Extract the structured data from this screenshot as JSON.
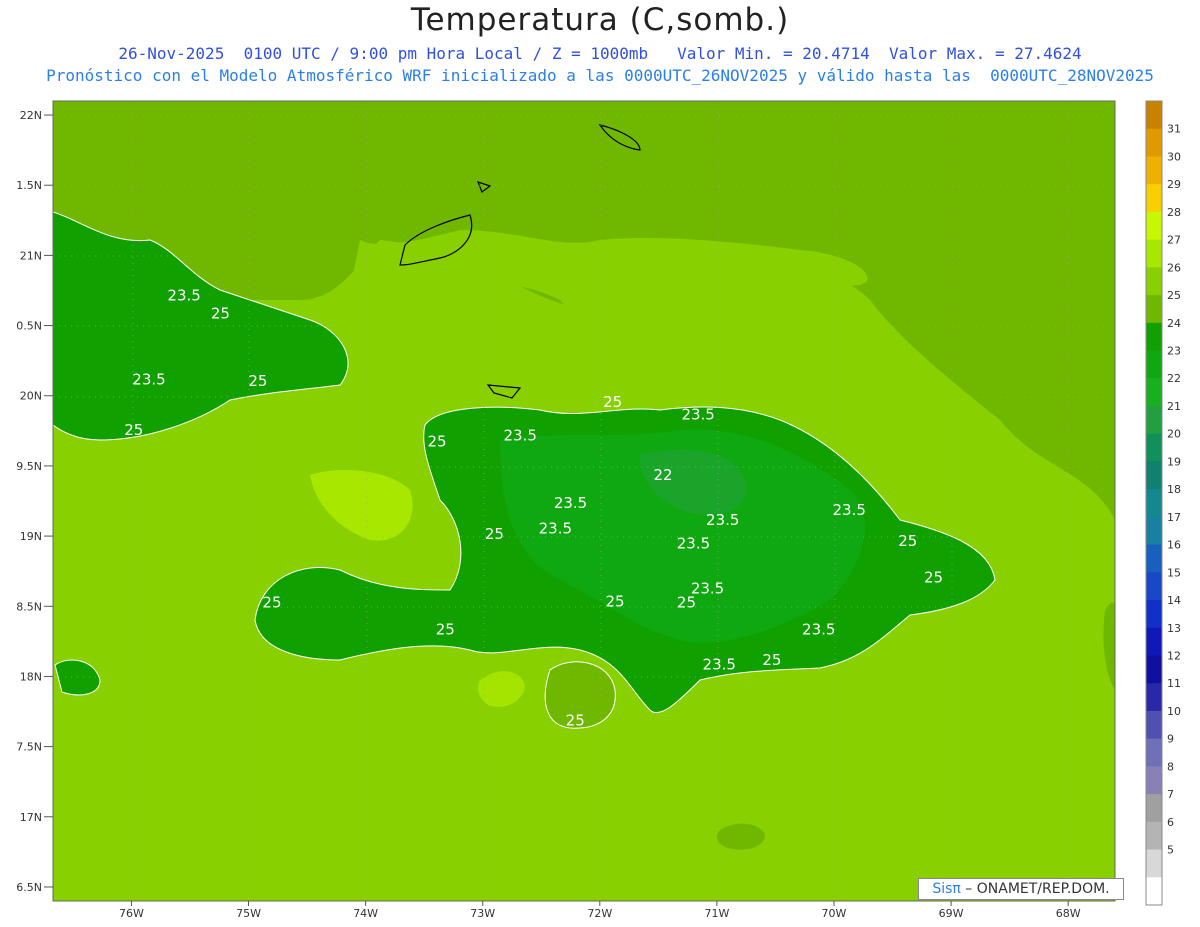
{
  "title": "Temperatura (C,somb.)",
  "subtitle_line1": "26-Nov-2025  0100 UTC / 9:00 pm Hora Local / Z = 1000mb   Valor Min. = 20.4714  Valor Max. = 27.4624",
  "subtitle_line2": "Pronóstico con el Modelo Atmosférico WRF inicializado a las 0000UTC_26NOV2025 y válido hasta las  0000UTC_28NOV2025",
  "lat_labels": [
    "22N",
    "1.5N",
    "21N",
    "0.5N",
    "20N",
    "9.5N",
    "19N",
    "8.5N",
    "18N",
    "7.5N",
    "17N",
    "6.5N"
  ],
  "lon_labels": [
    "76W",
    "75W",
    "74W",
    "73W",
    "72W",
    "71W",
    "70W",
    "69W",
    "68W"
  ],
  "colorbar": {
    "labels": [
      "31",
      "30",
      "29",
      "28",
      "27",
      "26",
      "25",
      "24",
      "23",
      "22",
      "21",
      "20",
      "19",
      "18",
      "17",
      "16",
      "15",
      "14",
      "13",
      "12",
      "11",
      "10",
      "9",
      "8",
      "7",
      "6",
      "5"
    ],
    "colors": [
      "#c88200",
      "#e09a00",
      "#f0b000",
      "#f8d000",
      "#c8f800",
      "#a8e800",
      "#88d000",
      "#70b800",
      "#10a000",
      "#10a810",
      "#18b020",
      "#22a040",
      "#10905a",
      "#108070",
      "#128890",
      "#1880a0",
      "#1860c0",
      "#1848c8",
      "#1030c8",
      "#1018b8",
      "#1010a0",
      "#2828a8",
      "#5050b0",
      "#7070b8",
      "#8a80b8",
      "#a0a0a0",
      "#b4b4b4",
      "#d8d8d8",
      "#ffffff"
    ]
  },
  "contour_labels": [
    {
      "text": "23.5",
      "lon": -75.55,
      "lat": 20.68
    },
    {
      "text": "25",
      "lon": -75.24,
      "lat": 20.55
    },
    {
      "text": "23.5",
      "lon": -75.85,
      "lat": 20.08
    },
    {
      "text": "25",
      "lon": -74.92,
      "lat": 20.07
    },
    {
      "text": "25",
      "lon": -75.98,
      "lat": 19.72
    },
    {
      "text": "25",
      "lon": -71.89,
      "lat": 19.92
    },
    {
      "text": "23.5",
      "lon": -71.16,
      "lat": 19.83
    },
    {
      "text": "23.5",
      "lon": -72.68,
      "lat": 19.68
    },
    {
      "text": "25",
      "lon": -73.39,
      "lat": 19.64
    },
    {
      "text": "22",
      "lon": -71.46,
      "lat": 19.4
    },
    {
      "text": "23.5",
      "lon": -72.25,
      "lat": 19.2
    },
    {
      "text": "23.5",
      "lon": -72.38,
      "lat": 19.02
    },
    {
      "text": "25",
      "lon": -72.9,
      "lat": 18.98
    },
    {
      "text": "23.5",
      "lon": -70.95,
      "lat": 19.08
    },
    {
      "text": "23.5",
      "lon": -69.87,
      "lat": 19.15
    },
    {
      "text": "25",
      "lon": -69.37,
      "lat": 18.93
    },
    {
      "text": "23.5",
      "lon": -71.2,
      "lat": 18.91
    },
    {
      "text": "25",
      "lon": -69.15,
      "lat": 18.67
    },
    {
      "text": "23.5",
      "lon": -71.08,
      "lat": 18.59
    },
    {
      "text": "25",
      "lon": -71.87,
      "lat": 18.5
    },
    {
      "text": "25",
      "lon": -71.26,
      "lat": 18.49
    },
    {
      "text": "25",
      "lon": -74.8,
      "lat": 18.49
    },
    {
      "text": "25",
      "lon": -73.32,
      "lat": 18.3
    },
    {
      "text": "23.5",
      "lon": -70.13,
      "lat": 18.3
    },
    {
      "text": "23.5",
      "lon": -70.98,
      "lat": 18.05
    },
    {
      "text": "25",
      "lon": -70.53,
      "lat": 18.08
    },
    {
      "text": "25",
      "lon": -72.21,
      "lat": 17.65
    }
  ],
  "credit": {
    "brand": "Sisπ",
    "text": " – ONAMET/REP.DOM."
  }
}
